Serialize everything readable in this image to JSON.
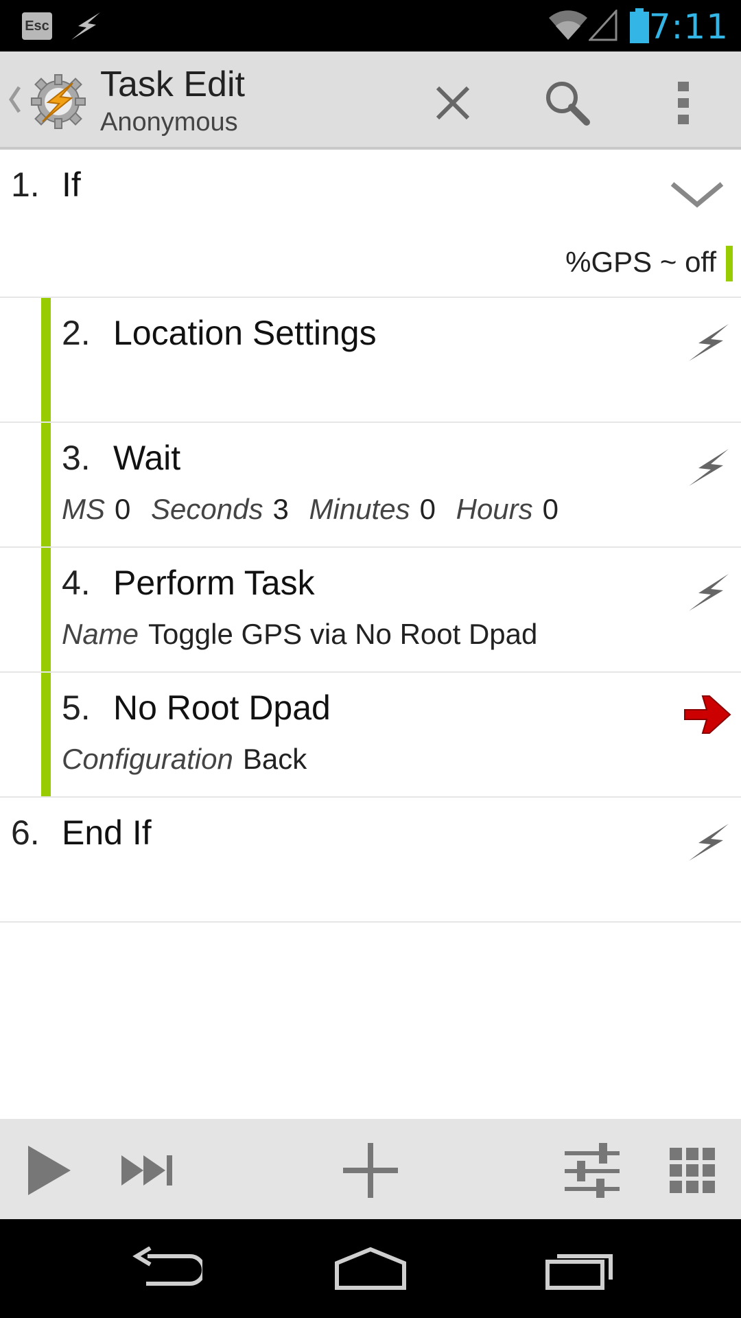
{
  "status_bar": {
    "esc_label": "Esc",
    "time": "7:11"
  },
  "action_bar": {
    "title": "Task Edit",
    "subtitle": "Anonymous"
  },
  "actions": [
    {
      "number": "1.",
      "name": "If",
      "args": [],
      "condition": "%GPS ~ off",
      "icon": "chevron-down-icon",
      "indented": false
    },
    {
      "number": "2.",
      "name": "Location Settings",
      "args": [],
      "icon": "bolt-icon",
      "indented": true
    },
    {
      "number": "3.",
      "name": "Wait",
      "args": [
        {
          "label": "MS",
          "value": "0"
        },
        {
          "label": "Seconds",
          "value": "3"
        },
        {
          "label": "Minutes",
          "value": "0"
        },
        {
          "label": "Hours",
          "value": "0"
        }
      ],
      "icon": "bolt-icon",
      "indented": true
    },
    {
      "number": "4.",
      "name": "Perform Task",
      "args": [
        {
          "label": "Name",
          "value": "Toggle GPS via No Root Dpad"
        }
      ],
      "icon": "bolt-icon",
      "indented": true
    },
    {
      "number": "5.",
      "name": "No Root Dpad",
      "args": [
        {
          "label": "Configuration",
          "value": "Back"
        }
      ],
      "icon": "arrow-right-icon",
      "indented": true
    },
    {
      "number": "6.",
      "name": "End If",
      "args": [],
      "icon": "bolt-icon",
      "indented": false
    }
  ],
  "colors": {
    "accent": "#99cc00",
    "status_blue": "#33b5e5",
    "arrow_red": "#cc0000"
  }
}
